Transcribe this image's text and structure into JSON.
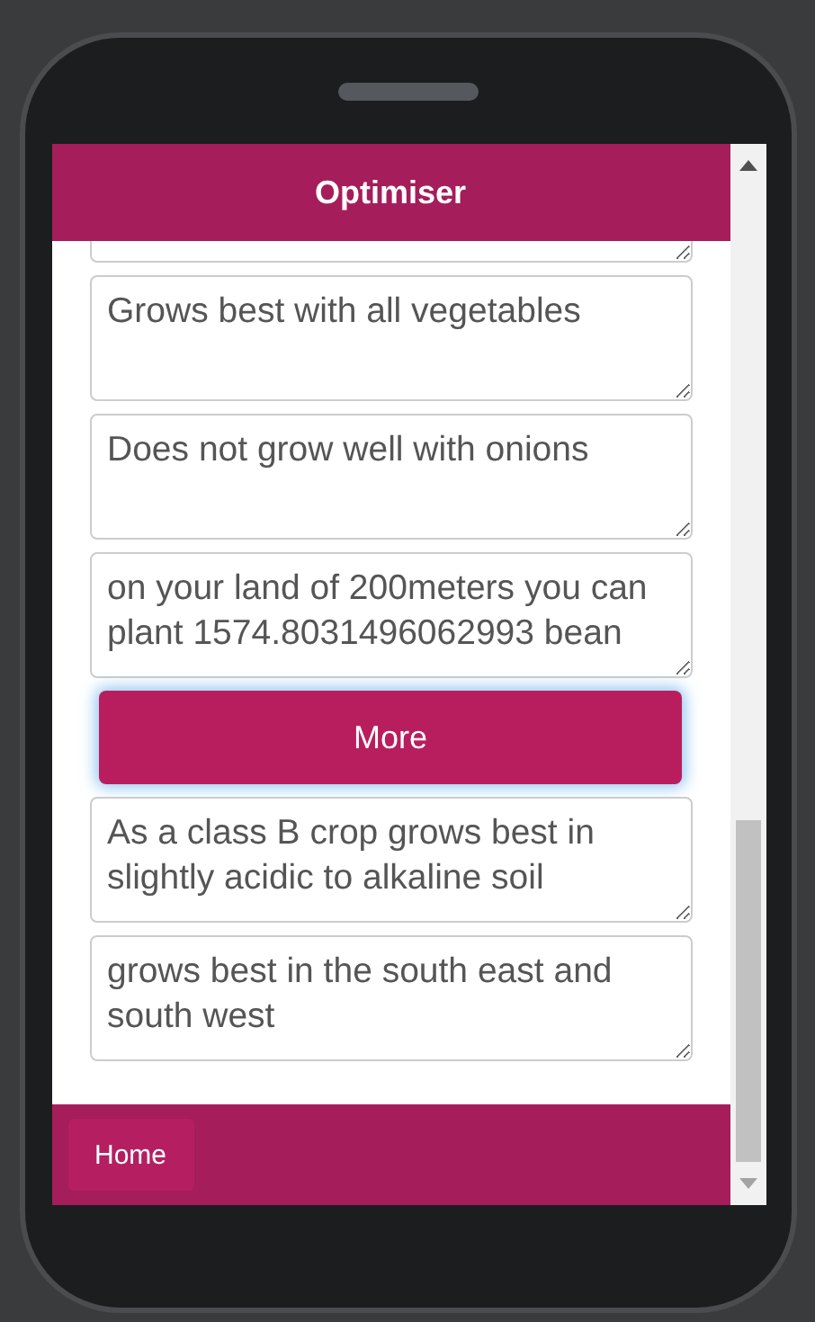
{
  "header": {
    "title": "Optimiser"
  },
  "fields_before": [
    {
      "clipped": true
    },
    {
      "value": "Grows best with all vegetables",
      "clipped": false
    },
    {
      "value": "Does not grow well with onions",
      "clipped": false
    },
    {
      "value": "on your land of 200meters you can plant 1574.8031496062993 bean",
      "clipped": false
    }
  ],
  "more_button": {
    "label": "More",
    "focused": true
  },
  "fields_after": [
    {
      "value": "As a class B crop grows best in slightly acidic to alkaline soil",
      "clipped": false
    },
    {
      "value": "grows best in the south east and south west",
      "clipped": false
    }
  ],
  "footer": {
    "buttons": [
      {
        "label": "Home"
      }
    ]
  }
}
